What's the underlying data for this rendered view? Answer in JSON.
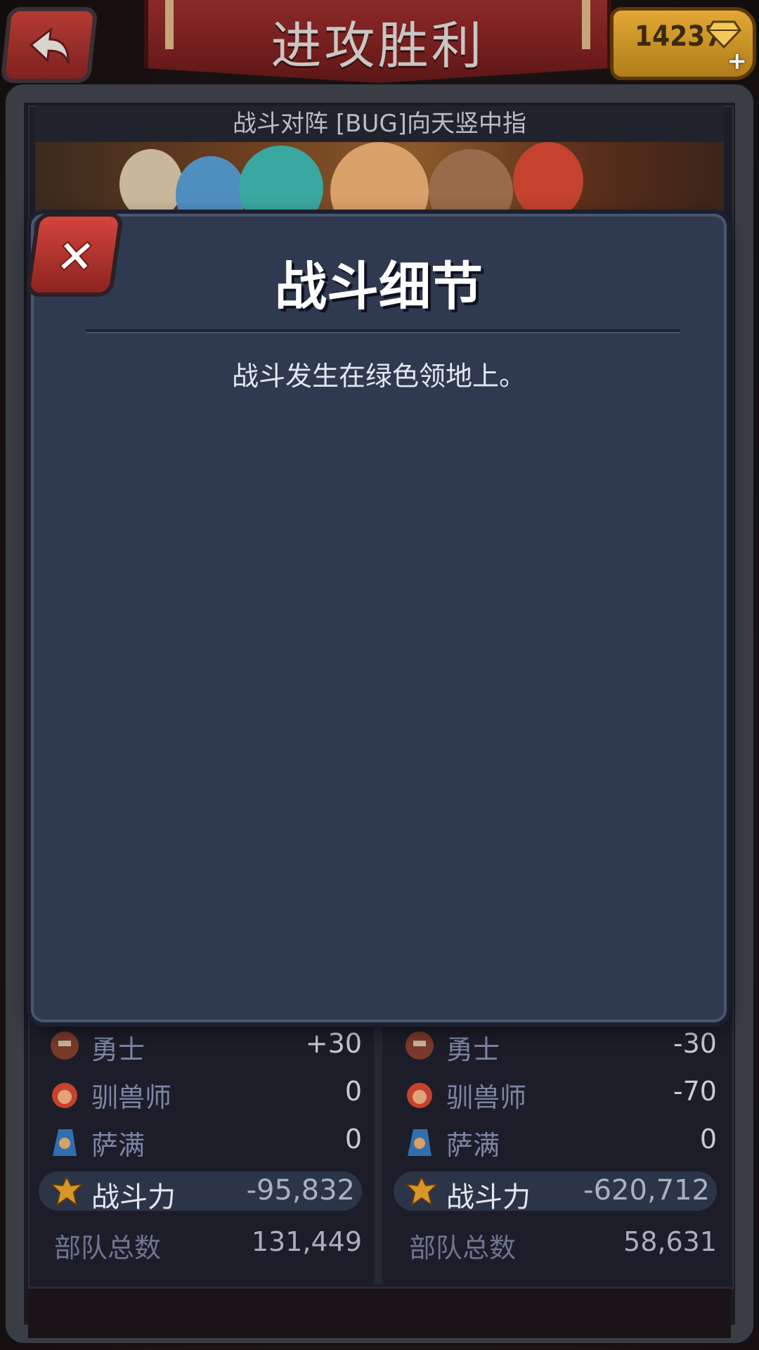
{
  "header": {
    "title": "进攻胜利",
    "currency": "14237"
  },
  "battle": {
    "opponents": "战斗对阵 [BUG]向天竖中指"
  },
  "modal": {
    "title": "战斗细节",
    "body": "战斗发生在绿色领地上。"
  },
  "left": {
    "units": [
      {
        "name": "勇士",
        "value": "+30",
        "icon": "warrior-icon"
      },
      {
        "name": "驯兽师",
        "value": "0",
        "icon": "beastmaster-icon"
      },
      {
        "name": "萨满",
        "value": "0",
        "icon": "shaman-icon"
      }
    ],
    "power_label": "战斗力",
    "power_value": "-95,832",
    "total_label": "部队总数",
    "total_value": "131,449"
  },
  "right": {
    "units": [
      {
        "name": "勇士",
        "value": "-30",
        "icon": "warrior-icon"
      },
      {
        "name": "驯兽师",
        "value": "-70",
        "icon": "beastmaster-icon"
      },
      {
        "name": "萨满",
        "value": "0",
        "icon": "shaman-icon"
      }
    ],
    "power_label": "战斗力",
    "power_value": "-620,712",
    "total_label": "部队总数",
    "total_value": "58,631"
  },
  "colors": {
    "banner": "#7a2222",
    "modal": "#2f394f",
    "gold": "#d69a2a"
  }
}
